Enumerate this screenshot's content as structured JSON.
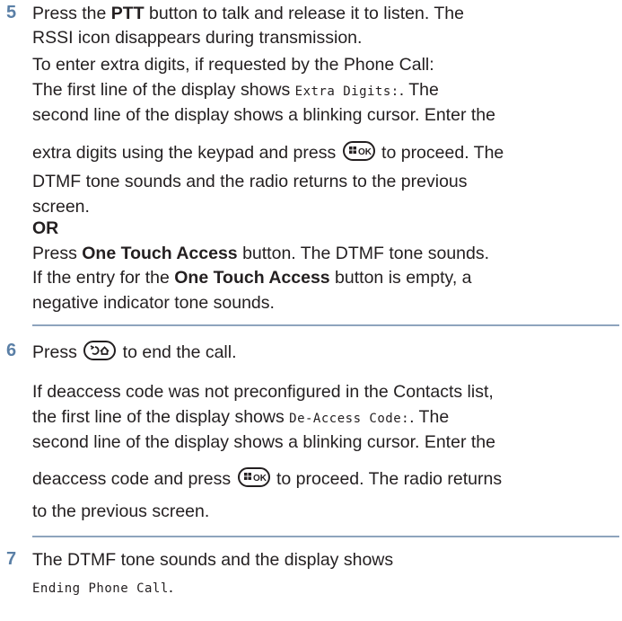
{
  "step5": {
    "number": "5",
    "l1_pre": "Press the ",
    "l1_bold": "PTT",
    "l1_post": " button to talk and release it to listen. The",
    "l2": "RSSI icon disappears during transmission.",
    "l3": "To enter extra digits, if requested by the Phone Call:",
    "l4_pre": "The first line of the display shows ",
    "l4_mono": "Extra Digits:",
    "l4_post": ". The",
    "l5": "second line of the display shows a blinking cursor. Enter the",
    "l6_pre": "extra digits using the keypad and press ",
    "l6_post": " to proceed. The",
    "l7": "DTMF tone sounds and the radio returns to the previous",
    "l8": "screen.",
    "or": "OR",
    "l9_pre": "Press ",
    "l9_bold": "One Touch Access",
    "l9_post": " button. The DTMF tone sounds.",
    "l10_pre": "If the entry for the ",
    "l10_bold": "One Touch Access",
    "l10_post": " button is empty, a",
    "l11": "negative indicator tone sounds."
  },
  "step6": {
    "number": "6",
    "l1_pre": "Press ",
    "l1_post": " to end the call.",
    "l2": "If deaccess code was not preconfigured in the Contacts list,",
    "l3_pre": "the first line of the display shows ",
    "l3_mono": "De-Access Code:",
    "l3_post": ". The",
    "l4": "second line of the display shows a blinking cursor. Enter the",
    "l5_pre": "deaccess code and press ",
    "l5_post": " to proceed. The radio returns",
    "l6": "to the previous screen."
  },
  "step7": {
    "number": "7",
    "l1": "The DTMF tone sounds and the display shows",
    "l2_mono": "Ending Phone Call",
    "l2_post": "."
  },
  "icons": {
    "menu_ok": "menu-ok-key-icon",
    "back_home": "back-home-key-icon"
  },
  "colors": {
    "step_number": "#5a7fa6",
    "rule": "#8ea4bd",
    "text": "#231f20"
  }
}
